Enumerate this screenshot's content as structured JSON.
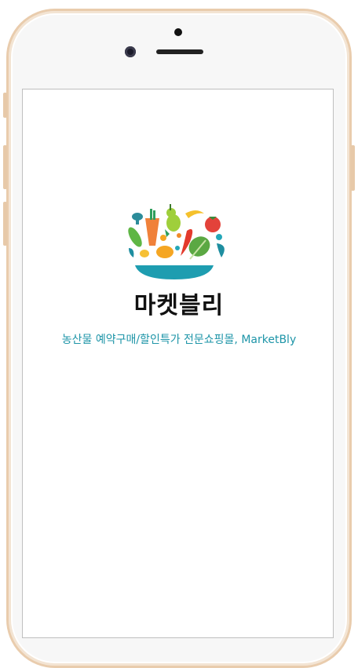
{
  "app": {
    "brand_name": "마켓블리",
    "tagline": "농산물 예약구매/할인특가 전문쇼핑몰, MarketBly"
  },
  "colors": {
    "accent": "#1e95a8",
    "phone_frame": "#e9ccad"
  },
  "icons": {
    "logo": "vegetable-bowl-icon"
  }
}
